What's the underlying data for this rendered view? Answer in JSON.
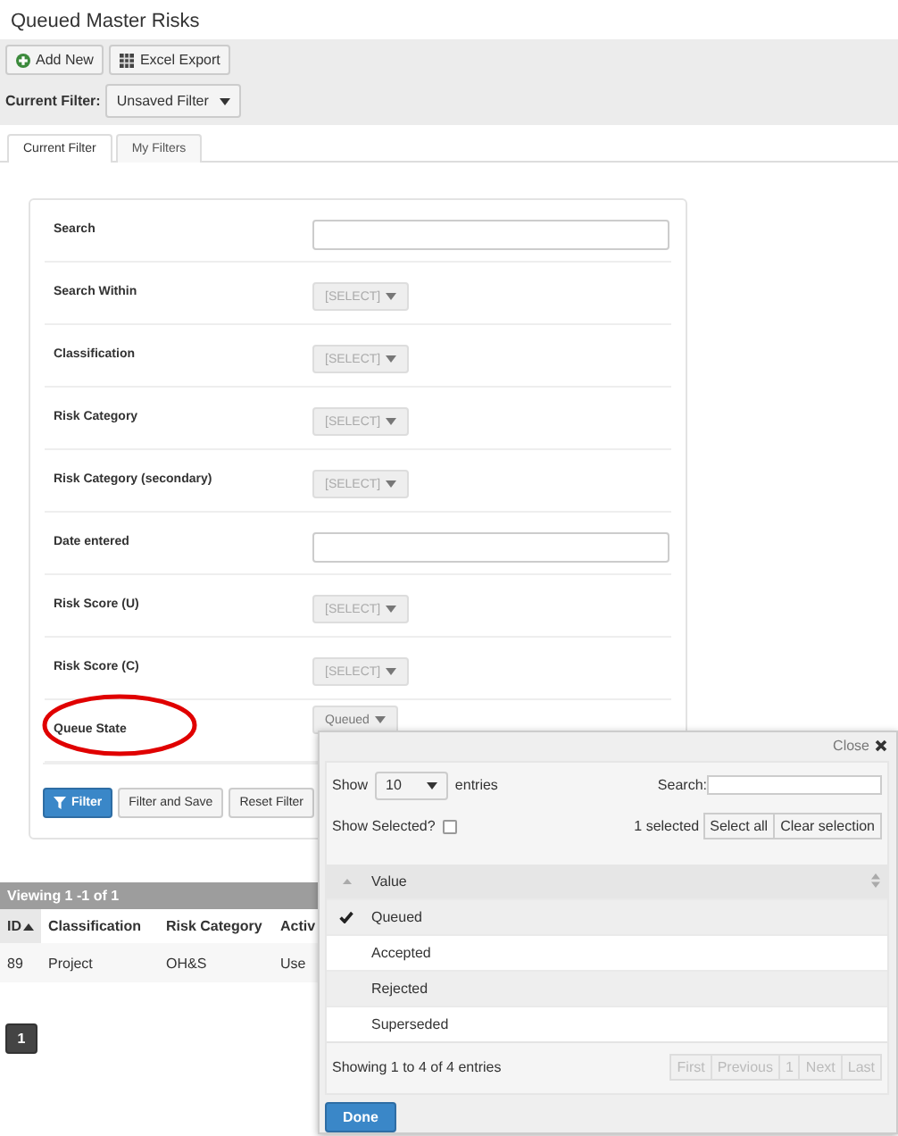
{
  "title": "Queued Master Risks",
  "toolbar": {
    "buttons": [
      {
        "label": "Add New"
      },
      {
        "label": "Excel Export"
      }
    ],
    "filter_label": "Current Filter:",
    "filter_value": "Unsaved Filter"
  },
  "tabs": [
    {
      "label": "Current Filter",
      "selected": true
    },
    {
      "label": "My Filters",
      "selected": false
    }
  ],
  "filter_fields": [
    {
      "label": "Search",
      "kind": "text",
      "circled": false
    },
    {
      "label": "Search Within",
      "kind": "select",
      "value": "[SELECT]",
      "circled": false
    },
    {
      "label": "Classification",
      "kind": "select",
      "value": "[SELECT]",
      "circled": false
    },
    {
      "label": "Risk Category",
      "kind": "select",
      "value": "[SELECT]",
      "circled": false
    },
    {
      "label": "Risk Category (secondary)",
      "kind": "select",
      "value": "[SELECT]",
      "circled": false
    },
    {
      "label": "Date entered",
      "kind": "text",
      "circled": false
    },
    {
      "label": "Risk Score (U)",
      "kind": "select",
      "value": "[SELECT]",
      "circled": false
    },
    {
      "label": "Risk Score (C)",
      "kind": "select",
      "value": "[SELECT]",
      "circled": false
    },
    {
      "label": "Queue State",
      "kind": "chosen",
      "value": "Queued",
      "circled": true
    }
  ],
  "filter_buttons": [
    {
      "label": "Filter",
      "kind": "primary"
    },
    {
      "label": "Filter and Save",
      "kind": "default"
    },
    {
      "label": "Reset Filter",
      "kind": "default"
    }
  ],
  "results": {
    "summary": "Viewing 1 -1 of 1",
    "columns": [
      {
        "label": "ID",
        "sorted": true
      },
      {
        "label": "Classification",
        "sorted": false
      },
      {
        "label": "Risk Category",
        "sorted": false
      },
      {
        "label": "Activ",
        "sorted": false
      }
    ],
    "rows": [
      [
        "89",
        "Project",
        "OH&S",
        "Use"
      ]
    ]
  },
  "pagination": [
    {
      "label": "1",
      "selected": true
    }
  ],
  "popup": {
    "close": "Close",
    "show_label": "Show",
    "page_size": "10",
    "entries_label": "entries",
    "search_label": "Search:",
    "show_selected_label": "Show Selected?",
    "show_selected": false,
    "selected_count": "1 selected",
    "select_all": "Select all",
    "clear_selection": "Clear selection",
    "column": "Value",
    "options": [
      {
        "label": "Queued",
        "selected": true
      },
      {
        "label": "Accepted",
        "selected": false
      },
      {
        "label": "Rejected",
        "selected": false
      },
      {
        "label": "Superseded",
        "selected": false
      }
    ],
    "info": "Showing 1 to 4 of 4 entries",
    "pager": [
      {
        "label": "First",
        "disabled": true
      },
      {
        "label": "Previous",
        "disabled": true
      },
      {
        "label": "1",
        "disabled": true
      },
      {
        "label": "Next",
        "disabled": true
      },
      {
        "label": "Last",
        "disabled": true
      }
    ],
    "done": "Done"
  }
}
